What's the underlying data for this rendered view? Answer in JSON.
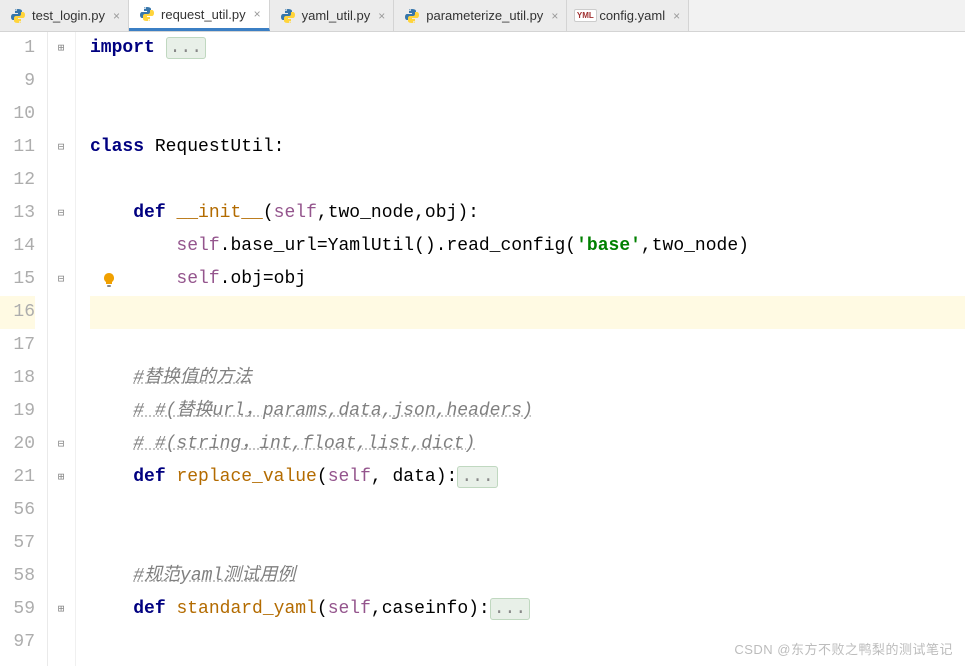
{
  "tabs": [
    {
      "label": "test_login.py",
      "type": "py",
      "active": false
    },
    {
      "label": "request_util.py",
      "type": "py",
      "active": true
    },
    {
      "label": "yaml_util.py",
      "type": "py",
      "active": false
    },
    {
      "label": "parameterize_util.py",
      "type": "py",
      "active": false
    },
    {
      "label": "config.yaml",
      "type": "yml",
      "active": false
    }
  ],
  "lineNumbers": [
    "1",
    "9",
    "10",
    "11",
    "12",
    "13",
    "14",
    "15",
    "16",
    "17",
    "18",
    "19",
    "20",
    "21",
    "56",
    "57",
    "58",
    "59",
    "97"
  ],
  "code": {
    "l1": {
      "kw": "import ",
      "folded": "..."
    },
    "l11": {
      "kw1": "class ",
      "name": "RequestUtil",
      "colon": ":"
    },
    "l13": {
      "kw": "def ",
      "fn": "__init__",
      "open": "(",
      "self": "self",
      "rest": ",two_node,obj):"
    },
    "l14": {
      "self": "self",
      "mid": ".base_url=YamlUtil().read_config(",
      "str": "'base'",
      "end": ",two_node)"
    },
    "l15": {
      "self": "self",
      "rest": ".obj=obj"
    },
    "l18": {
      "comment": "#替换值的方法"
    },
    "l19": {
      "comment": "# #(替换url，params,data,json,headers)"
    },
    "l20": {
      "comment": "# #(string，int,float,list,dict)"
    },
    "l21": {
      "kw": "def ",
      "fn": "replace_value",
      "open": "(",
      "self": "self",
      "mid": ", data):",
      "folded": "..."
    },
    "l58": {
      "comment": "#规范yaml测试用例"
    },
    "l59": {
      "kw": "def ",
      "fn": "standard_yaml",
      "open": "(",
      "self": "self",
      "mid": ",caseinfo):",
      "folded": "..."
    }
  },
  "watermark": "CSDN @东方不败之鸭梨的测试笔记",
  "icons": {
    "close": "×",
    "yml": "YML"
  }
}
